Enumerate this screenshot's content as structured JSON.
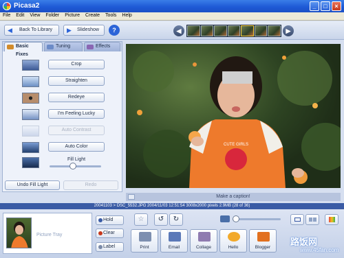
{
  "window": {
    "title": "Picasa2",
    "min": "_",
    "max": "□",
    "close": "×"
  },
  "menu": [
    "File",
    "Edit",
    "View",
    "Folder",
    "Picture",
    "Create",
    "Tools",
    "Help"
  ],
  "toolbar": {
    "back_label": "Back To Library",
    "slideshow_label": "Slideshow",
    "help_label": "?"
  },
  "tabs": [
    {
      "label": "Basic Fixes",
      "icon": "wrench-icon"
    },
    {
      "label": "Tuning",
      "icon": "sliders-icon"
    },
    {
      "label": "Effects",
      "icon": "brush-icon"
    }
  ],
  "fixes": [
    {
      "label": "Crop",
      "enabled": true
    },
    {
      "label": "Straighten",
      "enabled": true
    },
    {
      "label": "Redeye",
      "enabled": true
    },
    {
      "label": "I'm Feeling Lucky",
      "enabled": true
    },
    {
      "label": "Auto Contrast",
      "enabled": false
    },
    {
      "label": "Auto Color",
      "enabled": true
    }
  ],
  "fill_light": {
    "label": "Fill Light",
    "value": 0.45
  },
  "undo_label": "Undo Fill Light",
  "redo_label": "Redo",
  "caption_placeholder": "Make a caption!",
  "info": "20041103 > DSC_5532.JPG    2004/11/03 12:51:54    3008x2000 pixels    2.9MB    (28 of 36)",
  "tray": {
    "label": "Picture Tray",
    "hold": "Hold",
    "clear": "Clear",
    "label_btn": "Label"
  },
  "actions": [
    {
      "label": "Print",
      "color": "#7d8fb0"
    },
    {
      "label": "Email",
      "color": "#5b79b8"
    },
    {
      "label": "Collage",
      "color": "#8f7bb0"
    },
    {
      "label": "Hello",
      "color": "#f2a92a"
    },
    {
      "label": "Blogger",
      "color": "#e2701e"
    }
  ],
  "watermark": {
    "main": "路饭网",
    "sub": "www.45fan.com"
  }
}
